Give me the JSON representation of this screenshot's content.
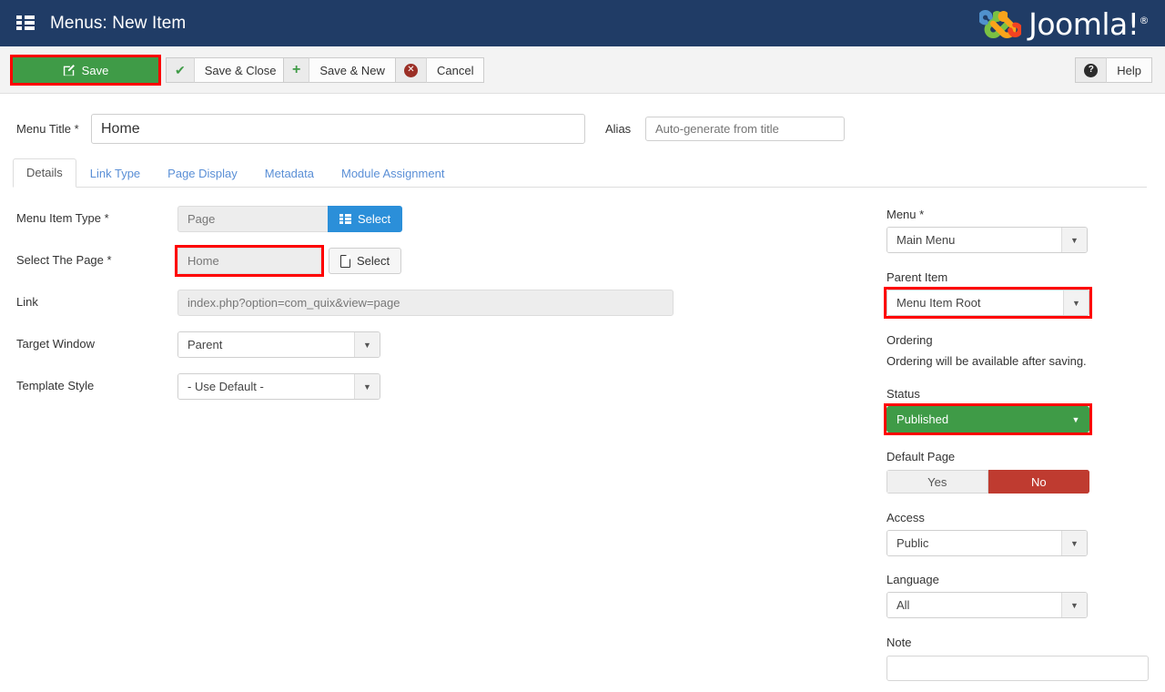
{
  "header": {
    "icon": "list-icon",
    "title": "Menus: New Item",
    "brand": "Joomla!",
    "brand_reg": "®"
  },
  "toolbar": {
    "save_label": "Save",
    "save_icon": "edit-square-icon",
    "save_close_label": "Save & Close",
    "save_close_icon": "check-icon",
    "save_new_label": "Save & New",
    "save_new_icon": "plus-icon",
    "cancel_label": "Cancel",
    "cancel_icon": "x-circle-icon",
    "help_label": "Help",
    "help_icon": "question-circle-icon"
  },
  "title_row": {
    "menu_title_label": "Menu Title *",
    "menu_title_value": "Home",
    "alias_label": "Alias",
    "alias_placeholder": "Auto-generate from title"
  },
  "tabs": [
    {
      "label": "Details",
      "active": true
    },
    {
      "label": "Link Type",
      "active": false
    },
    {
      "label": "Page Display",
      "active": false
    },
    {
      "label": "Metadata",
      "active": false
    },
    {
      "label": "Module Assignment",
      "active": false
    }
  ],
  "left_form": {
    "menu_item_type": {
      "label": "Menu Item Type *",
      "value": "Page",
      "button_label": "Select",
      "button_icon": "list-icon"
    },
    "select_the_page": {
      "label": "Select The Page *",
      "value": "Home",
      "button_label": "Select",
      "button_icon": "document-icon"
    },
    "link": {
      "label": "Link",
      "value": "index.php?option=com_quix&view=page"
    },
    "target_window": {
      "label": "Target Window",
      "value": "Parent"
    },
    "template_style": {
      "label": "Template Style",
      "value": "- Use Default -"
    }
  },
  "right_form": {
    "menu": {
      "label": "Menu *",
      "value": "Main Menu"
    },
    "parent_item": {
      "label": "Parent Item",
      "value": "Menu Item Root"
    },
    "ordering": {
      "label": "Ordering",
      "helper": "Ordering will be available after saving."
    },
    "status": {
      "label": "Status",
      "value": "Published"
    },
    "default_page": {
      "label": "Default Page",
      "yes_label": "Yes",
      "no_label": "No",
      "selected": "No"
    },
    "access": {
      "label": "Access",
      "value": "Public"
    },
    "language": {
      "label": "Language",
      "value": "All"
    },
    "note": {
      "label": "Note",
      "value": ""
    }
  },
  "colors": {
    "header_navy": "#203c66",
    "success_green": "#3f9b47",
    "danger_red": "#bf3b30",
    "accent_blue": "#2b8fd9",
    "highlight_red": "#ff0000",
    "link_blue": "#5a8fd6"
  }
}
